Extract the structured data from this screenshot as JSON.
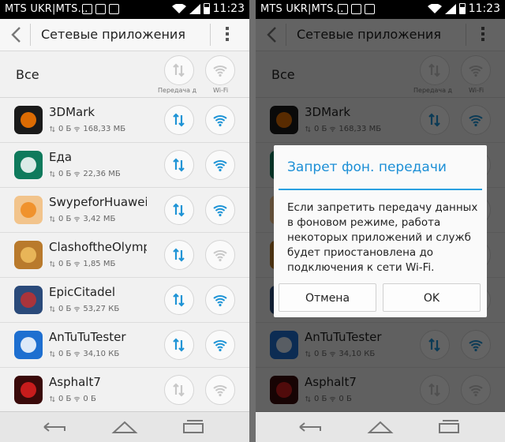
{
  "status_bar": {
    "carrier": "MTS UKR|MTS...",
    "time": "11:23"
  },
  "action_bar": {
    "title": "Сетевые приложения"
  },
  "header": {
    "all_label": "Все",
    "col_data_label": "Передача д",
    "col_wifi_label": "Wi-Fi"
  },
  "apps": [
    {
      "name": "3DMark",
      "data": "0 Б",
      "wifi": "168,33 МБ",
      "icon_bg": "#1a1a1a",
      "icon_fg": "#ff7a00",
      "mobile_on": true,
      "wifi_on": true
    },
    {
      "name": "Еда",
      "data": "0 Б",
      "wifi": "22,36 МБ",
      "icon_bg": "#0f7a5c",
      "icon_fg": "#ffffff",
      "mobile_on": true,
      "wifi_on": true
    },
    {
      "name": "SwypeforHuawei",
      "data": "0 Б",
      "wifi": "3,42 МБ",
      "icon_bg": "#f2c48c",
      "icon_fg": "#f08a1c",
      "mobile_on": true,
      "wifi_on": true
    },
    {
      "name": "ClashoftheOlympians",
      "data": "0 Б",
      "wifi": "1,85 МБ",
      "icon_bg": "#b97a2c",
      "icon_fg": "#f0c060",
      "mobile_on": true,
      "wifi_on": false
    },
    {
      "name": "EpicCitadel",
      "data": "0 Б",
      "wifi": "53,27 КБ",
      "icon_bg": "#2a4a7a",
      "icon_fg": "#c03030",
      "mobile_on": true,
      "wifi_on": true
    },
    {
      "name": "AnTuTuTester",
      "data": "0 Б",
      "wifi": "34,10 КБ",
      "icon_bg": "#1e6fd0",
      "icon_fg": "#ffffff",
      "mobile_on": true,
      "wifi_on": true
    },
    {
      "name": "Asphalt7",
      "data": "0 Б",
      "wifi": "0 Б",
      "icon_bg": "#3a0a0a",
      "icon_fg": "#e02020",
      "mobile_on": false,
      "wifi_on": false
    }
  ],
  "dialog": {
    "title": "Запрет фон. передачи",
    "message": "Если запретить передачу данных в фоновом режиме, работа некоторых приложений и служб будет приостановлена до подключения к сети Wi-Fi.",
    "cancel_label": "Отмена",
    "ok_label": "OK"
  },
  "colors": {
    "accent": "#1c8fd6",
    "active_icon": "#1f94d6",
    "inactive_icon": "#c8c8c8"
  },
  "icons": {
    "back": "chevron-left-icon",
    "menu": "overflow-menu-icon",
    "mobile_data": "data-arrows-icon",
    "wifi": "wifi-icon",
    "nav_back": "back-icon",
    "nav_home": "home-icon",
    "nav_recent": "recent-apps-icon"
  }
}
